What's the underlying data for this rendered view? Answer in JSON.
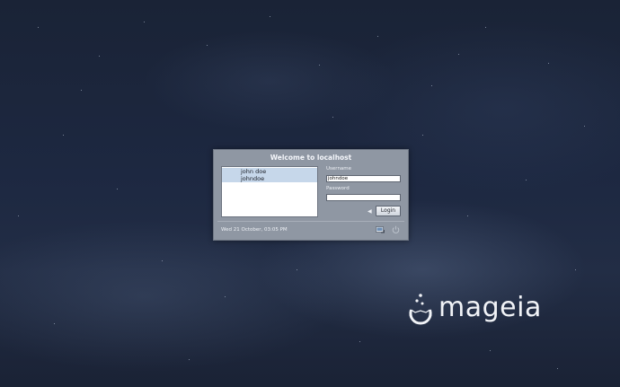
{
  "dialog": {
    "title": "Welcome to localhost",
    "users": [
      {
        "name": "john doe",
        "selected": true
      },
      {
        "name": "johndoe",
        "selected": true
      }
    ],
    "username_label": "Username",
    "username_value": "johndoe",
    "password_label": "Password",
    "password_value": "",
    "login_label": "Login",
    "datetime": "Wed 21 October, 03:05 PM"
  },
  "brand": {
    "text": "mageia",
    "color": "#f1f3f7"
  },
  "colors": {
    "background": "#1d2841",
    "dialog": "#8f97a3",
    "selection": "#c6d7ea"
  },
  "icons": [
    "user-avatar-icon",
    "arrow-right-icon",
    "session-menu-icon",
    "power-icon",
    "mageia-logo-icon"
  ]
}
